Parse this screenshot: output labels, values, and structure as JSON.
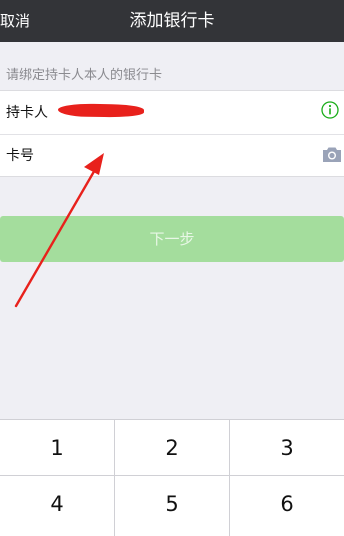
{
  "navbar": {
    "cancel_label": "取消",
    "title": "添加银行卡"
  },
  "form": {
    "hint": "请绑定持卡人本人的银行卡",
    "holder_label": "持卡人",
    "card_label": "卡号",
    "card_value": "",
    "info_icon": "info-icon",
    "camera_icon": "camera-icon"
  },
  "next_label": "下一步",
  "keypad": {
    "keys": [
      "1",
      "2",
      "3",
      "4",
      "5",
      "6"
    ]
  },
  "colors": {
    "navbar_bg": "#333438",
    "accent_green": "#1aad19",
    "button_disabled": "#a4dd9d",
    "annotation_red": "#e8211c"
  }
}
